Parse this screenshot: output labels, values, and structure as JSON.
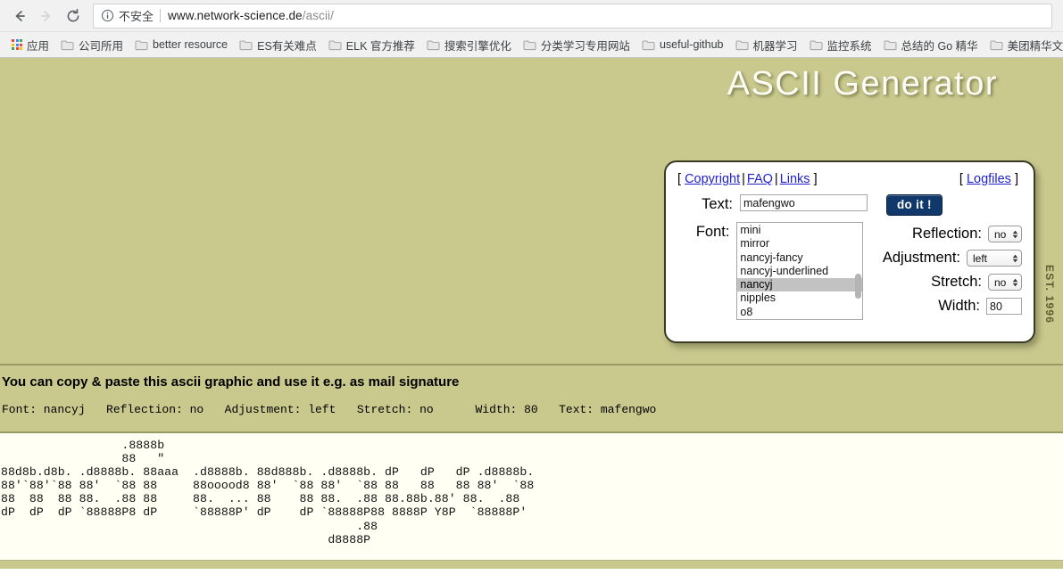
{
  "browser": {
    "back_tooltip": "Back",
    "forward_tooltip": "Forward",
    "reload_tooltip": "Reload",
    "security_label": "不安全",
    "url_domain": "www.network-science.de",
    "url_path": "/ascii/",
    "bookmarks": [
      {
        "label": "应用",
        "icon": "apps-grid-icon"
      },
      {
        "label": "公司所用",
        "icon": "folder-icon"
      },
      {
        "label": "better resource",
        "icon": "folder-icon"
      },
      {
        "label": "ES有关难点",
        "icon": "folder-icon"
      },
      {
        "label": "ELK 官方推荐",
        "icon": "folder-icon"
      },
      {
        "label": "搜索引擎优化",
        "icon": "folder-icon"
      },
      {
        "label": "分类学习专用网站",
        "icon": "folder-icon"
      },
      {
        "label": "useful-github",
        "icon": "folder-icon"
      },
      {
        "label": "机器学习",
        "icon": "folder-icon"
      },
      {
        "label": "监控系统",
        "icon": "folder-icon"
      },
      {
        "label": "总结的 Go 精华",
        "icon": "folder-icon"
      },
      {
        "label": "美团精华文",
        "icon": "folder-icon"
      }
    ]
  },
  "site": {
    "title": "ASCII Generator",
    "est_badge": "EST. 1996",
    "background_color": "#c9c98e",
    "title_color": "#fcfcf4",
    "link_color": "#2222cc",
    "button_color": "#11386b",
    "output_background": "#fffff4"
  },
  "nav": {
    "bracket_open": "[",
    "bracket_close": "]",
    "pipe": "|",
    "copyright": "Copyright",
    "faq": "FAQ",
    "links": "Links",
    "logfiles": "Logfiles"
  },
  "form": {
    "text_label": "Text:",
    "text_value": "mafengwo",
    "submit_label": "do it !",
    "font_label": "Font:",
    "font_options": [
      "mini",
      "mirror",
      "nancyj-fancy",
      "nancyj-underlined",
      "nancyj",
      "nipples",
      "o8"
    ],
    "font_selected": "nancyj",
    "reflection_label": "Reflection:",
    "reflection_value": "no",
    "adjustment_label": "Adjustment:",
    "adjustment_value": "left",
    "stretch_label": "Stretch:",
    "stretch_value": "no",
    "width_label": "Width:",
    "width_value": "80"
  },
  "results": {
    "notice": "You can copy & paste this ascii graphic and use it e.g. as mail signature",
    "params_line": "Font: nancyj   Reflection: no   Adjustment: left   Stretch: no      Width: 80   Text: mafengwo",
    "ascii_art": "                 .8888b\n                 88   \"\n88d8b.d8b. .d8888b. 88aaa  .d8888b. 88d888b. .d8888b. dP   dP   dP .d8888b.\n88'`88'`88 88'  `88 88     88ooood8 88'  `88 88'  `88 88   88   88 88'  `88\n88  88  88 88.  .88 88     88.  ... 88    88 88.  .88 88.88b.88' 88.  .88\ndP  dP  dP `88888P8 dP     `88888P' dP    dP `88888P88 8888P Y8P  `88888P'\n                                                  .88\n                                              d8888P"
  }
}
